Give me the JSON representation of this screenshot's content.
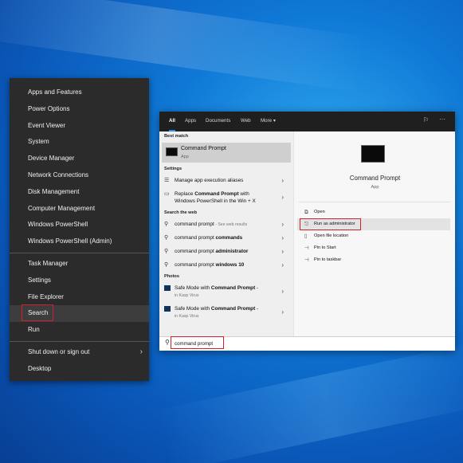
{
  "winx_menu": {
    "group1": [
      "Apps and Features",
      "Power Options",
      "Event Viewer",
      "System",
      "Device Manager",
      "Network Connections",
      "Disk Management",
      "Computer Management",
      "Windows PowerShell",
      "Windows PowerShell (Admin)"
    ],
    "group2": [
      "Task Manager",
      "Settings",
      "File Explorer",
      "Search",
      "Run"
    ],
    "group3": [
      "Shut down or sign out",
      "Desktop"
    ],
    "highlighted": "Search"
  },
  "search": {
    "tabs": [
      "All",
      "Apps",
      "Documents",
      "Web",
      "More ▾"
    ],
    "active_tab": "All",
    "best_match_header": "Best match",
    "best_match": {
      "title": "Command Prompt",
      "subtitle": "App"
    },
    "settings_header": "Settings",
    "settings": [
      {
        "text": "Manage app execution aliases"
      },
      {
        "pre": "Replace ",
        "bold": "Command Prompt",
        "post": " with",
        "line2": "Windows PowerShell in the Win + X"
      }
    ],
    "web_header": "Search the web",
    "web": [
      {
        "pre": "command prompt",
        "bold": "",
        "faint": " - See web results"
      },
      {
        "pre": "command prompt ",
        "bold": "commands",
        "faint": ""
      },
      {
        "pre": "command prompt ",
        "bold": "administrator",
        "faint": ""
      },
      {
        "pre": "command prompt ",
        "bold": "windows 10",
        "faint": ""
      }
    ],
    "photos_header": "Photos",
    "photos": [
      {
        "pre": "Safe Mode with ",
        "bold": "Command Prompt",
        "post": " -",
        "sub": "in Kasp Virus"
      },
      {
        "pre": "Safe Mode with ",
        "bold": "Command Prompt",
        "post": " -",
        "sub": "in Kasp Virus"
      }
    ],
    "preview": {
      "title": "Command Prompt",
      "subtitle": "App",
      "actions": [
        "Open",
        "Run as administrator",
        "Open file location",
        "Pin to Start",
        "Pin to taskbar"
      ]
    },
    "query": "command prompt"
  },
  "colors": {
    "highlight_box": "#d21f2b",
    "tab_underline": "#2d8ae8"
  }
}
